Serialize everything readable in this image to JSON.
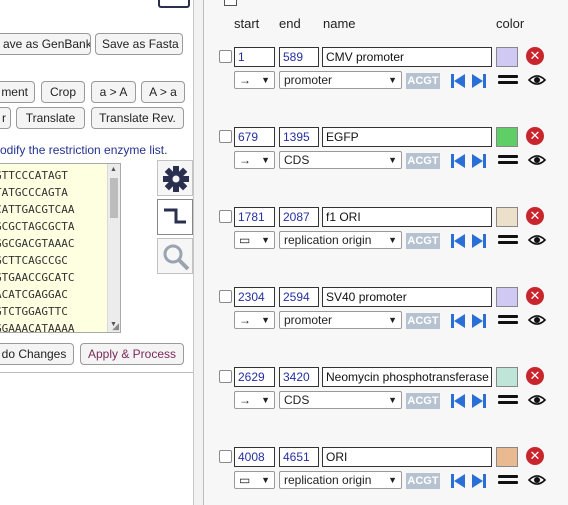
{
  "toolbar": {
    "save_genbank": "ave as GenBank",
    "save_fasta": "Save as Fasta",
    "complement": "ment",
    "crop": "Crop",
    "a_to_A": "a > A",
    "A_to_a": "A > a",
    "reverse_partial": "r",
    "translate": "Translate",
    "translate_rev": "Translate Rev."
  },
  "hint_text": "odify the restriction enzyme list.",
  "sequence_lines": [
    "GTTCCCATAGT",
    "TATGCCCAGTA",
    "CATTGACGTCAA",
    "GCGCTAGCGCTA",
    "GGCGACGTAAAC",
    "GCTTCAGCCGC",
    "GTGAACCGCATC",
    "ACATCGAGGAC",
    "GTCTGGAGTTC",
    "GGAAACATAAAA"
  ],
  "bottom_buttons": {
    "undo": "do Changes",
    "apply": "Apply & Process"
  },
  "columns": {
    "start": "start",
    "end": "end",
    "name": "name",
    "color": "color"
  },
  "features": [
    {
      "start": "1",
      "end": "589",
      "name": "CMV promoter",
      "direction": "→",
      "type": "promoter",
      "color": "#cfc9f3"
    },
    {
      "start": "679",
      "end": "1395",
      "name": "EGFP",
      "direction": "→",
      "type": "CDS",
      "color": "#5fce66"
    },
    {
      "start": "1781",
      "end": "2087",
      "name": "f1 ORI",
      "direction": "▭",
      "type": "replication origin",
      "color": "#ece0cb"
    },
    {
      "start": "2304",
      "end": "2594",
      "name": "SV40 promoter",
      "direction": "→",
      "type": "promoter",
      "color": "#cfc9f3"
    },
    {
      "start": "2629",
      "end": "3420",
      "name": "Neomycin phosphotransferase",
      "direction": "→",
      "type": "CDS",
      "color": "#bfe4d8"
    },
    {
      "start": "4008",
      "end": "4651",
      "name": "ORI",
      "direction": "▭",
      "type": "replication origin",
      "color": "#e9b991"
    }
  ],
  "acgt_label": "ACGT",
  "colors": {
    "accent_blue": "#2a6fd6",
    "delete_red": "#c8262c",
    "apply_text": "#7a2a5a"
  }
}
